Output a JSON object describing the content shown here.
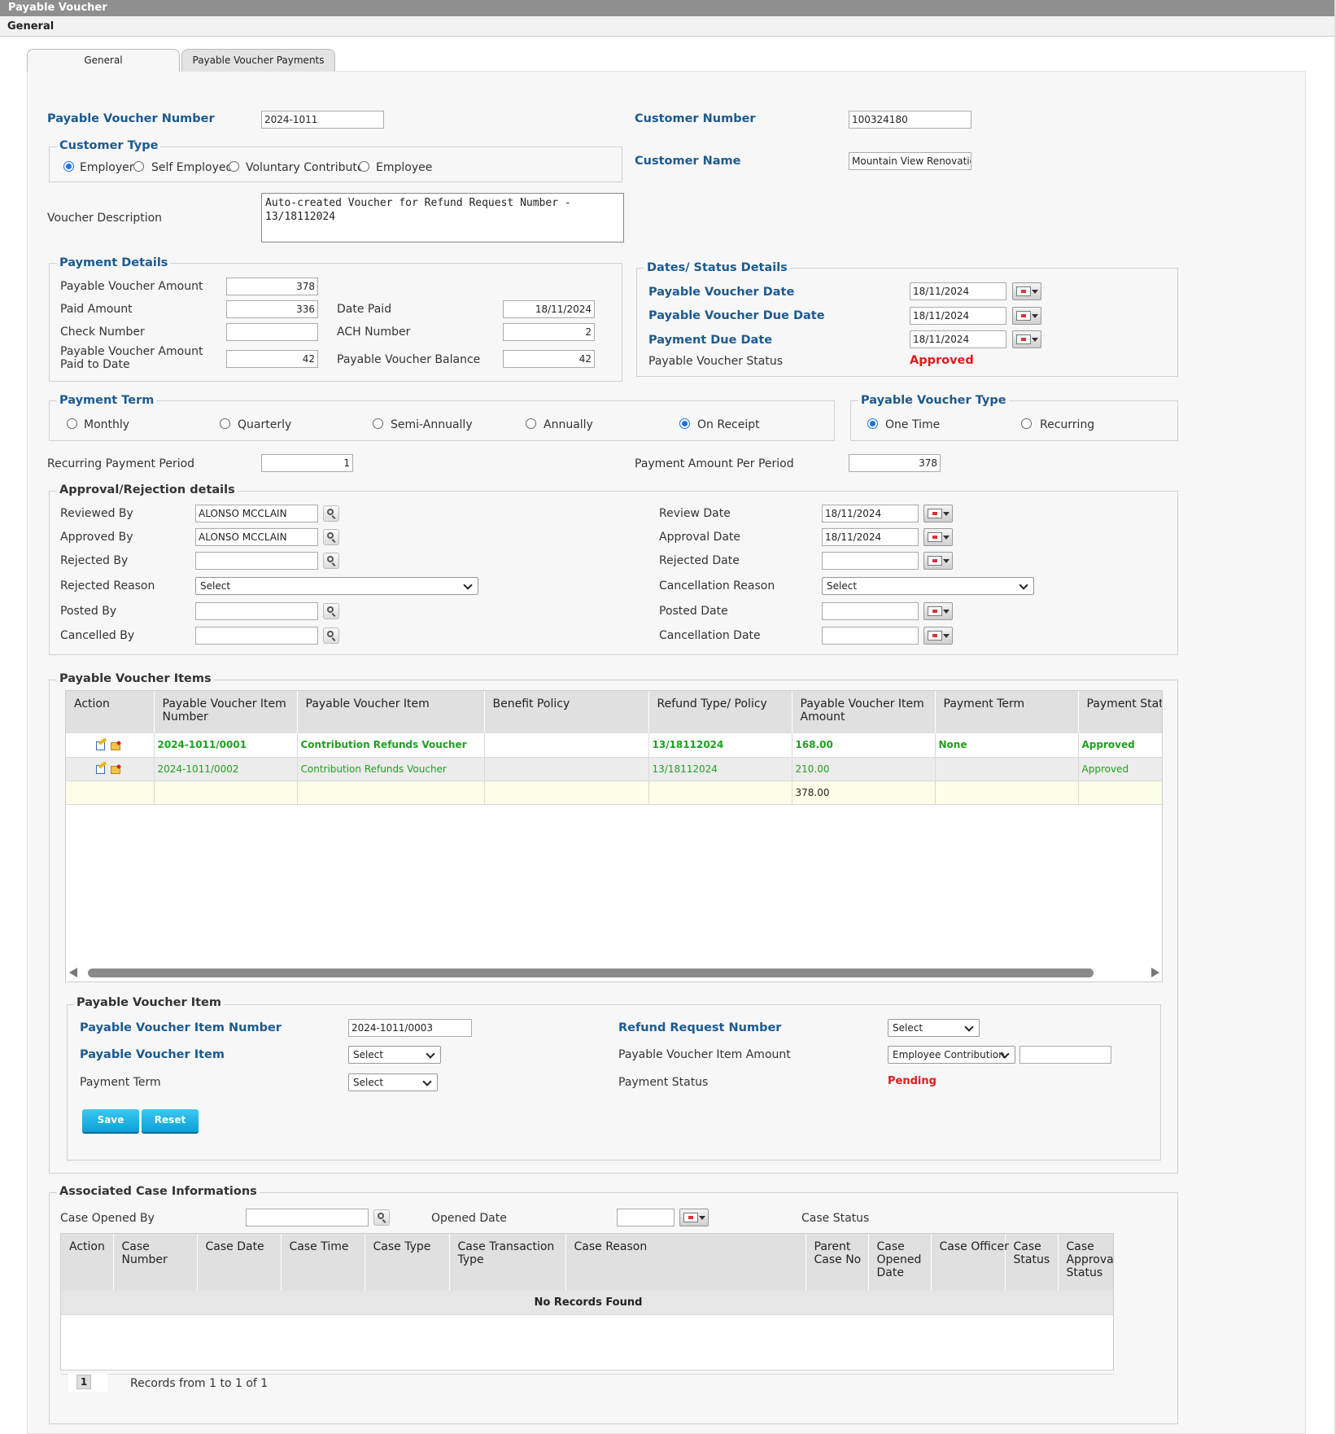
{
  "window": {
    "title": "Payable Voucher",
    "section": "General"
  },
  "tabs": [
    "General",
    "Payable Voucher Payments"
  ],
  "header": {
    "voucher_number_label": "Payable Voucher Number",
    "voucher_number": "2024-1011",
    "customer_number_label": "Customer Number",
    "customer_number": "100324180",
    "customer_type_legend": "Customer Type",
    "customer_types": [
      "Employer",
      "Self Employed",
      "Voluntary Contributor",
      "Employee"
    ],
    "customer_type_selected": "Employer",
    "customer_name_label": "Customer Name",
    "customer_name": "Mountain View Renovations",
    "description_label": "Voucher Description",
    "description": "Auto-created Voucher for Refund Request Number - 13/18112024"
  },
  "payment_details": {
    "legend": "Payment Details",
    "amount_label": "Payable Voucher Amount",
    "amount": "378",
    "paid_label": "Paid Amount",
    "paid": "336",
    "date_paid_label": "Date Paid",
    "date_paid": "18/11/2024",
    "check_label": "Check Number",
    "check": "",
    "ach_label": "ACH Number",
    "ach": "2",
    "paid_to_date_label": "Payable Voucher Amount Paid to Date",
    "paid_to_date": "42",
    "balance_label": "Payable Voucher Balance",
    "balance": "42"
  },
  "dates_status": {
    "legend": "Dates/ Status Details",
    "voucher_date_label": "Payable Voucher Date",
    "voucher_date": "18/11/2024",
    "due_date_label": "Payable Voucher Due Date",
    "due_date": "18/11/2024",
    "payment_due_label": "Payment Due Date",
    "payment_due": "18/11/2024",
    "status_label": "Payable Voucher Status",
    "status": "Approved"
  },
  "payment_term": {
    "legend": "Payment Term",
    "options": [
      "Monthly",
      "Quarterly",
      "Semi-Annually",
      "Annually",
      "On Receipt"
    ],
    "selected": "On Receipt"
  },
  "voucher_type": {
    "legend": "Payable Voucher Type",
    "options": [
      "One Time",
      "Recurring"
    ],
    "selected": "One Time"
  },
  "recurring": {
    "period_label": "Recurring Payment Period",
    "period": "1",
    "per_period_label": "Payment Amount Per Period",
    "per_period": "378"
  },
  "approval": {
    "legend": "Approval/Rejection details",
    "reviewed_by_label": "Reviewed By",
    "reviewed_by": "ALONSO MCCLAIN",
    "approved_by_label": "Approved By",
    "approved_by": "ALONSO MCCLAIN",
    "rejected_by_label": "Rejected By",
    "rejected_by": "",
    "rejected_reason_label": "Rejected Reason",
    "rejected_reason": "Select",
    "posted_by_label": "Posted By",
    "posted_by": "",
    "cancelled_by_label": "Cancelled By",
    "cancelled_by": "",
    "review_date_label": "Review Date",
    "review_date": "18/11/2024",
    "approval_date_label": "Approval Date",
    "approval_date": "18/11/2024",
    "rejected_date_label": "Rejected Date",
    "rejected_date": "",
    "cancellation_reason_label": "Cancellation Reason",
    "cancellation_reason": "Select",
    "posted_date_label": "Posted Date",
    "posted_date": "",
    "cancellation_date_label": "Cancellation Date",
    "cancellation_date": ""
  },
  "items": {
    "legend": "Payable Voucher Items",
    "columns": [
      "Action",
      "Payable Voucher Item Number",
      "Payable Voucher Item",
      "Benefit Policy",
      "Refund Type/ Policy",
      "Payable Voucher Item Amount",
      "Payment Term",
      "Payment Status"
    ],
    "rows": [
      {
        "number": "2024-1011/0001",
        "item": "Contribution Refunds Voucher",
        "benefit": "",
        "refund": "13/18112024",
        "amount": "168.00",
        "term": "None",
        "status": "Approved"
      },
      {
        "number": "2024-1011/0002",
        "item": "Contribution Refunds Voucher",
        "benefit": "",
        "refund": "13/18112024",
        "amount": "210.00",
        "term": "",
        "status": "Approved"
      }
    ],
    "total": "378.00",
    "icons": [
      "edit-icon",
      "delete-icon"
    ]
  },
  "item_form": {
    "legend": "Payable Voucher Item",
    "number_label": "Payable Voucher Item Number",
    "number": "2024-1011/0003",
    "refund_label": "Refund Request Number",
    "refund": "Select",
    "item_label": "Payable Voucher Item",
    "item": "Select",
    "amount_label": "Payable Voucher Item Amount",
    "amount_type": "Employee Contribution",
    "amount": "",
    "term_label": "Payment Term",
    "term": "Select",
    "status_label": "Payment Status",
    "status": "Pending",
    "save": "Save",
    "reset": "Reset"
  },
  "cases": {
    "legend": "Associated Case Informations",
    "opened_by_label": "Case Opened By",
    "opened_by": "",
    "opened_date_label": "Opened Date",
    "opened_date": "",
    "status_label": "Case Status",
    "columns": [
      "Action",
      "Case Number",
      "Case Date",
      "Case Time",
      "Case Type",
      "Case Transaction Type",
      "Case Reason",
      "Parent Case No",
      "Case Opened Date",
      "Case Officer",
      "Case Status",
      "Case Approval Status"
    ],
    "empty": "No Records Found",
    "page": "1",
    "records": "Records from 1 to 1 of 1"
  },
  "colors": {
    "label_blue": "#1c5a8f",
    "approved_red": "#e01b1b",
    "green": "#1ea11e",
    "button": "#0aa0d8"
  }
}
